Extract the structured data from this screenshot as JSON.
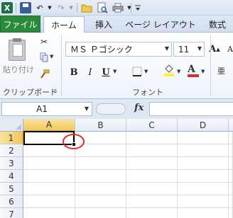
{
  "qat": {
    "logo_letter": "X",
    "icons": [
      "excel-logo-icon",
      "save-icon",
      "undo-icon",
      "redo-icon",
      "open-folder-icon",
      "print-preview-icon",
      "print-icon",
      "customize-qat-icon"
    ]
  },
  "tabs": [
    {
      "label": "ファイル",
      "name": "tab-file"
    },
    {
      "label": "ホーム",
      "name": "tab-home"
    },
    {
      "label": "挿入",
      "name": "tab-insert"
    },
    {
      "label": "ページ レイアウト",
      "name": "tab-page-layout"
    },
    {
      "label": "数式",
      "name": "tab-formulas"
    }
  ],
  "ribbon": {
    "clipboard": {
      "paste_label": "貼り付け",
      "group_label": "クリップボード"
    },
    "font": {
      "font_name": "ＭＳ Ｐゴシック",
      "font_size": "11",
      "bold": "B",
      "italic": "I",
      "underline": "U",
      "grow": "A",
      "shrink": "A",
      "font_color_letter": "A",
      "group_label": "フォント"
    },
    "colors": {
      "font_color_bar": "#e22a2a",
      "fill_color_bar": "#ffef38",
      "file_tab": "#2a8a3c"
    }
  },
  "formula_bar": {
    "name_box": "A1",
    "fx_label": "fx",
    "formula_value": ""
  },
  "sheet": {
    "columns": [
      "A",
      "B",
      "C",
      "D"
    ],
    "rows": [
      "1",
      "2",
      "3",
      "4",
      "5",
      "6",
      "7"
    ],
    "active_cell": "A1",
    "annotation_color": "#e0262b"
  }
}
